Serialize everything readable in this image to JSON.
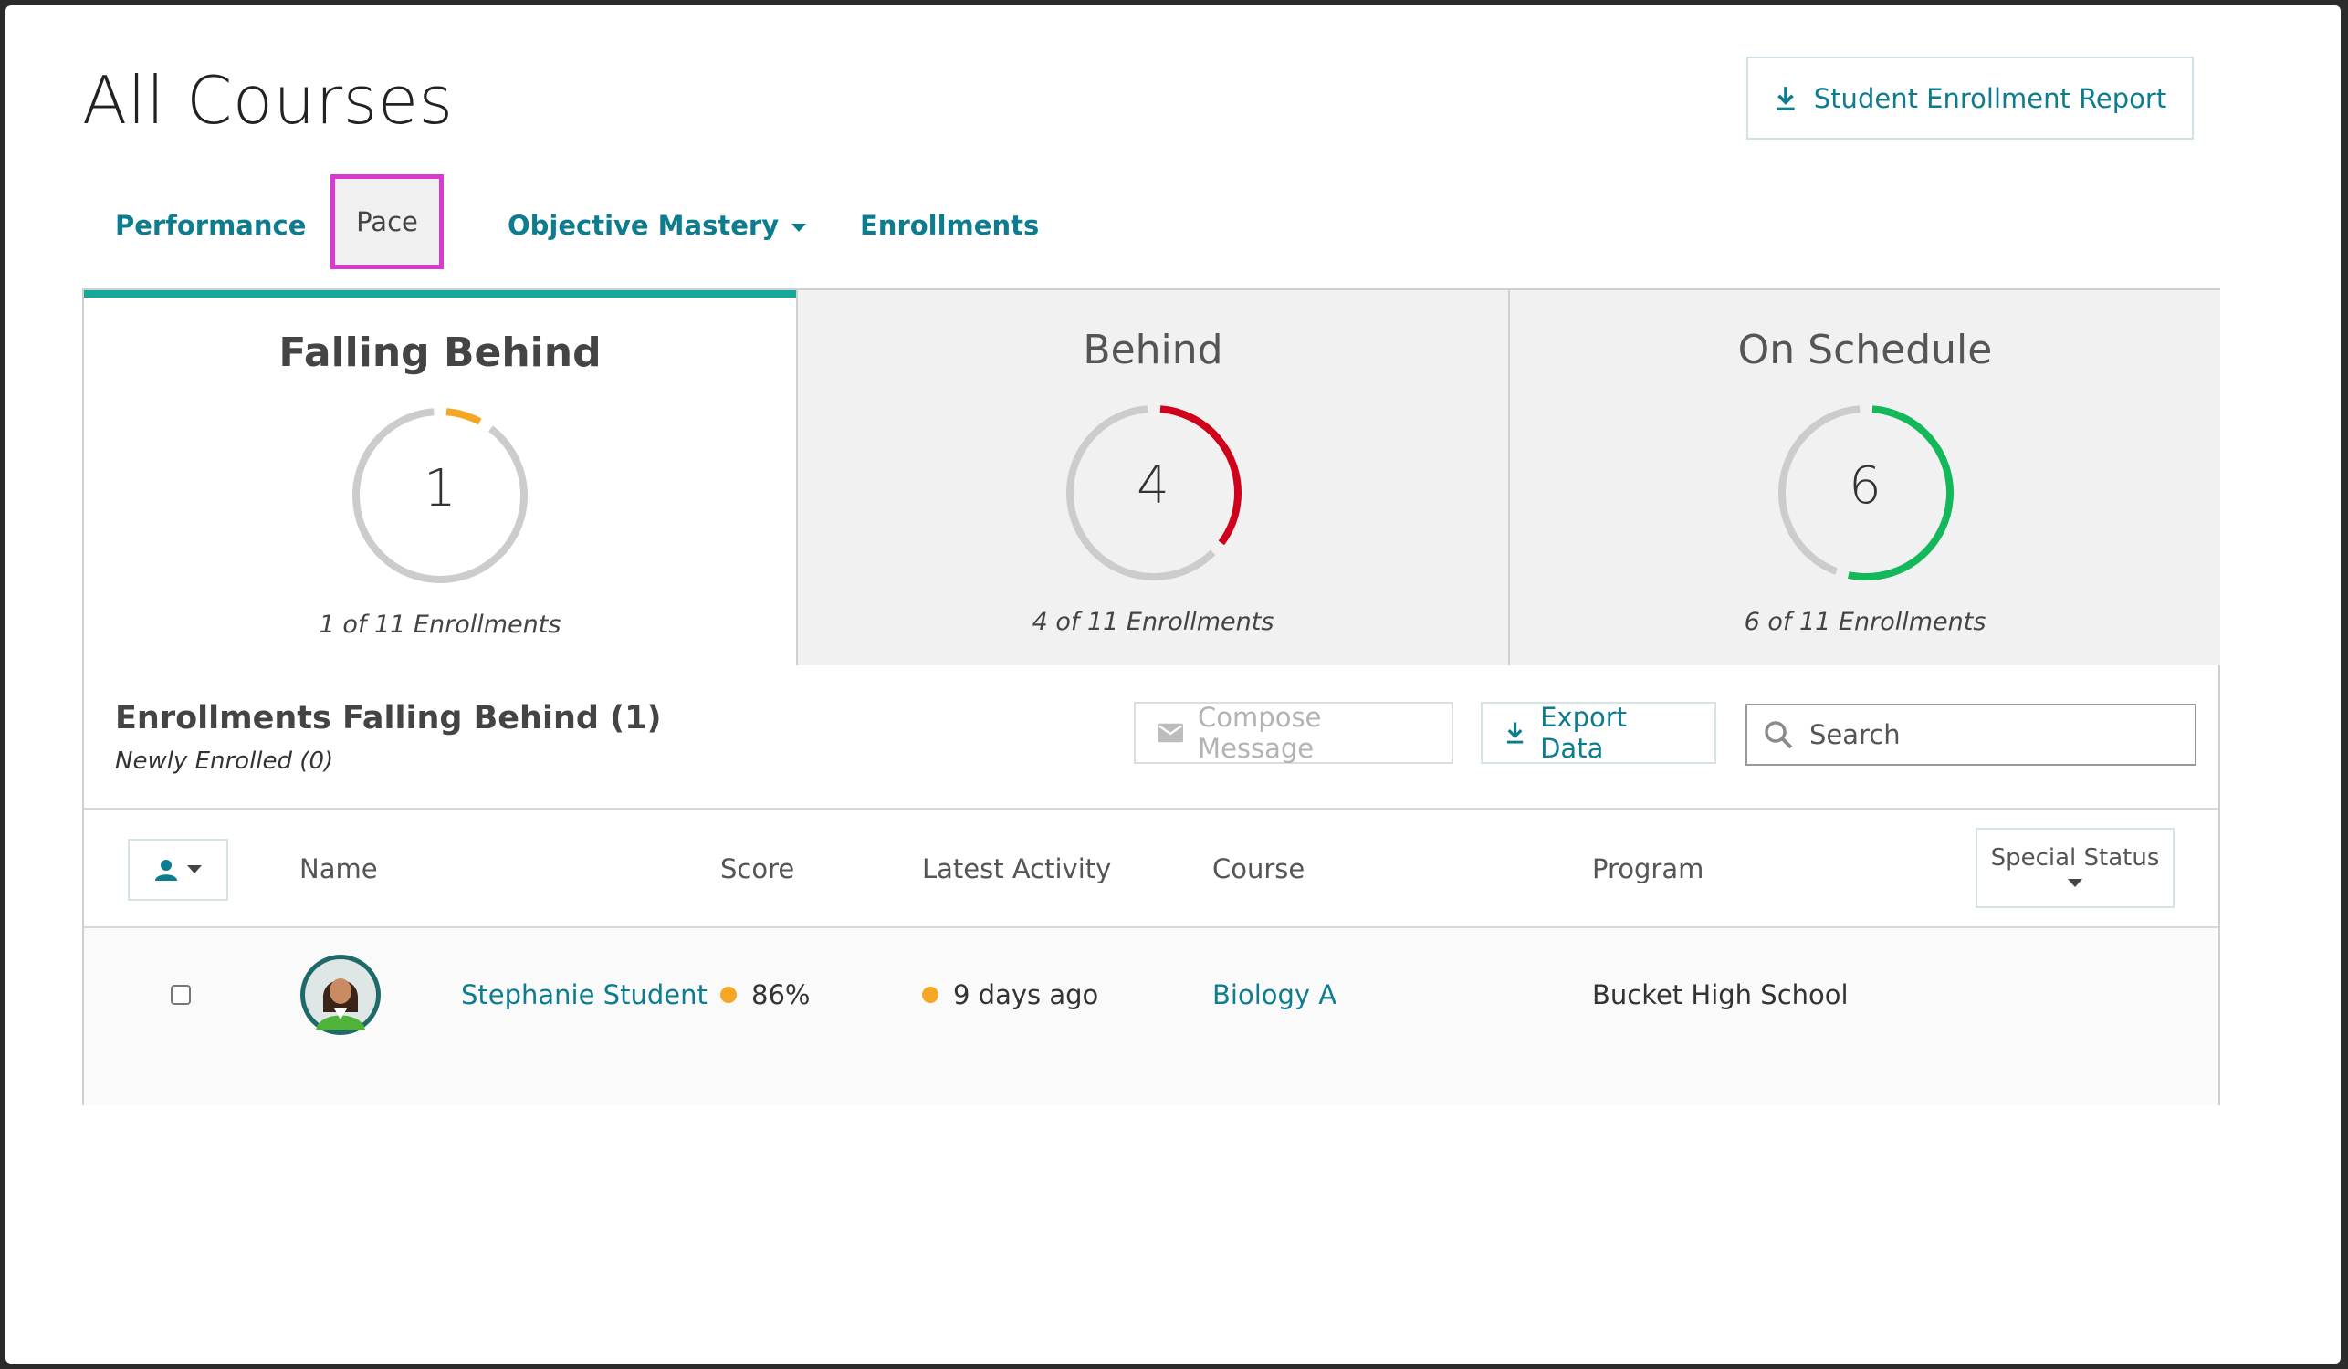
{
  "page": {
    "title": "All Courses"
  },
  "header": {
    "report_button_label": "Student Enrollment Report"
  },
  "tabs": [
    {
      "label": "Performance"
    },
    {
      "label": "Pace"
    },
    {
      "label": "Objective Mastery"
    },
    {
      "label": "Enrollments"
    }
  ],
  "summary_cards": [
    {
      "title": "Falling Behind",
      "count": "1",
      "subtitle": "1 of 11 Enrollments",
      "fraction": 0.0909,
      "color": "#f5a623"
    },
    {
      "title": "Behind",
      "count": "4",
      "subtitle": "4 of 11 Enrollments",
      "fraction": 0.3636,
      "color": "#d0021b"
    },
    {
      "title": "On Schedule",
      "count": "6",
      "subtitle": "6 of 11 Enrollments",
      "fraction": 0.5454,
      "color": "#13b85a"
    }
  ],
  "section": {
    "title": "Enrollments Falling Behind (1)",
    "subtitle": "Newly Enrolled (0)",
    "compose_label": "Compose Message",
    "export_label": "Export Data",
    "search_placeholder": "Search"
  },
  "table": {
    "columns": {
      "name": "Name",
      "score": "Score",
      "latest_activity": "Latest Activity",
      "course": "Course",
      "program": "Program",
      "special_status": "Special Status"
    },
    "rows": [
      {
        "name": "Stephanie Student",
        "score": "86%",
        "latest_activity": "9 days ago",
        "course": "Biology A",
        "program": "Bucket High School",
        "score_color": "#f5a623",
        "activity_color": "#f5a623"
      }
    ]
  },
  "colors": {
    "accent": "#0e7c8f",
    "tab_underline": "#16a99a",
    "ring_track": "#cccccc"
  }
}
